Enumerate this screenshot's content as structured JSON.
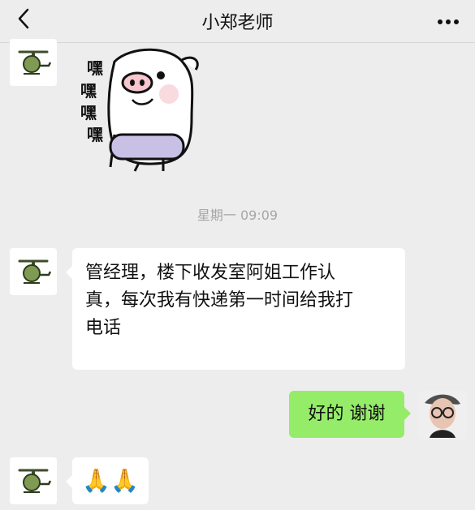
{
  "header": {
    "title": "小郑老师",
    "back_icon": "chevron-left-icon",
    "more_icon": "more-dots-icon"
  },
  "messages": [
    {
      "sender": "teacher",
      "type": "sticker",
      "sticker_text": [
        "嘿",
        "嘿",
        "嘿",
        "嘿"
      ]
    },
    {
      "type": "timestamp",
      "text": "星期一 09:09"
    },
    {
      "sender": "teacher",
      "type": "text",
      "lines": [
        "管经理，楼下收发室阿姐工作认",
        "真，每次我有快递第一时间给我打",
        "电话"
      ]
    },
    {
      "sender": "me",
      "type": "text",
      "text": "好的 谢谢"
    },
    {
      "sender": "teacher",
      "type": "emoji",
      "text": "🙏🙏"
    }
  ]
}
